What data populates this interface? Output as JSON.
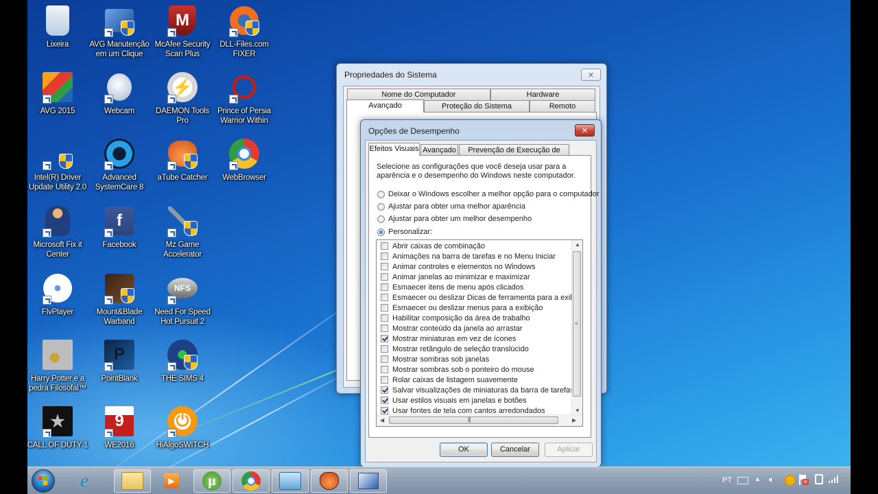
{
  "desktop": {
    "icons": [
      {
        "label": "Lixeira",
        "icon": "recycle-bin-icon"
      },
      {
        "label": "AVG Manutenção em um Clique",
        "icon": "avg-pc-tuneup-icon"
      },
      {
        "label": "McAfee Security Scan Plus",
        "icon": "mcafee-shield-icon"
      },
      {
        "label": "DLL-Files.com FIXER",
        "icon": "dll-fixer-gear-icon"
      },
      {
        "label": "AVG 2015",
        "icon": "avg-antivirus-icon"
      },
      {
        "label": "Webcam",
        "icon": "webcam-icon"
      },
      {
        "label": "DAEMON Tools Pro",
        "icon": "daemon-tools-icon"
      },
      {
        "label": "Prince of Persia Warrior Within",
        "icon": "prince-of-persia-icon"
      },
      {
        "label": "Intel(R) Driver Update Utility 2.0",
        "icon": "intel-driver-icon"
      },
      {
        "label": "Advanced SystemCare 8",
        "icon": "advanced-systemcare-icon"
      },
      {
        "label": "aTube Catcher",
        "icon": "atube-catcher-glove-icon"
      },
      {
        "label": "WebBrowser",
        "icon": "web-browser-icon"
      },
      {
        "label": "Microsoft Fix it Center",
        "icon": "fix-it-mechanic-icon"
      },
      {
        "label": "Facebook",
        "icon": "facebook-icon"
      },
      {
        "label": "Mz Game Accelerator",
        "icon": "wrench-icon"
      },
      {
        "label": "FlvPlayer",
        "icon": "film-reel-icon"
      },
      {
        "label": "Mount&Blade Warband",
        "icon": "horse-icon"
      },
      {
        "label": "Need For Speed Hot Pursuit 2",
        "icon": "nfs-logo-icon"
      },
      {
        "label": "Harry Potter e a pedra Filosofal™",
        "icon": "snitch-icon"
      },
      {
        "label": "PointBlank",
        "icon": "pointblank-icon"
      },
      {
        "label": "THE SIMS 4",
        "icon": "sims-plumbob-icon"
      },
      {
        "label": "CALL OF DUTY 1",
        "icon": "star-icon"
      },
      {
        "label": "WE2016",
        "icon": "we9-icon"
      },
      {
        "label": "HiAlgoSWITCH",
        "icon": "power-icon"
      }
    ]
  },
  "system_properties": {
    "title": "Propriedades do Sistema",
    "tabs_row1": [
      "Nome do Computador",
      "Hardware"
    ],
    "tabs_row2": [
      "Avançado",
      "Proteção do Sistema",
      "Remoto"
    ],
    "selected_tab": "Avançado"
  },
  "performance_options": {
    "title": "Opções de Desempenho",
    "tabs": [
      "Efeitos Visuais",
      "Avançado",
      "Prevenção de Execução de Dados"
    ],
    "selected_tab": "Efeitos Visuais",
    "description": "Selecione as configurações que você deseja usar para a aparência e o desempenho do Windows neste computador.",
    "description_lines": [
      "Selecione as configurações que você deseja usar para a",
      "aparência e o desempenho do Windows neste computador."
    ],
    "radio_options": [
      {
        "label": "Deixar o Windows escolher a melhor opção para o computador",
        "selected": false
      },
      {
        "label": "Ajustar para obter uma melhor aparência",
        "selected": false
      },
      {
        "label": "Ajustar para obter um melhor desempenho",
        "selected": false
      },
      {
        "label": "Personalizar:",
        "selected": true
      }
    ],
    "effects": [
      {
        "label": "Abrir caixas de combinação",
        "checked": false
      },
      {
        "label": "Animações na barra de tarefas e no Menu Iniciar",
        "checked": false
      },
      {
        "label": "Animar controles e elementos no Windows",
        "checked": false
      },
      {
        "label": "Animar janelas ao minimizar e maximizar",
        "checked": false
      },
      {
        "label": "Esmaecer itens de menu após clicados",
        "checked": false
      },
      {
        "label": "Esmaecer ou deslizar Dicas de ferramenta para a exibição",
        "checked": false
      },
      {
        "label": "Esmaecer ou deslizar menus para a exibição",
        "checked": false
      },
      {
        "label": "Habilitar composição da área de trabalho",
        "checked": false
      },
      {
        "label": "Mostrar conteúdo da janela ao arrastar",
        "checked": false
      },
      {
        "label": "Mostrar miniaturas em vez de ícones",
        "checked": true
      },
      {
        "label": "Mostrar retângulo de seleção translúcido",
        "checked": false
      },
      {
        "label": "Mostrar sombras sob janelas",
        "checked": false
      },
      {
        "label": "Mostrar sombras sob o ponteiro do mouse",
        "checked": false
      },
      {
        "label": "Rolar caixas de listagem suavemente",
        "checked": false
      },
      {
        "label": "Salvar visualizações de miniaturas da barra de tarefas",
        "checked": true
      },
      {
        "label": "Usar estilos visuais em janelas e botões",
        "checked": true
      },
      {
        "label": "Usar fontes de tela com cantos arredondados",
        "checked": true
      }
    ],
    "buttons": {
      "ok": "OK",
      "cancel": "Cancelar",
      "apply": "Aplicar"
    },
    "apply_enabled": false
  },
  "taskbar": {
    "start": "start-orb-icon",
    "items": [
      {
        "name": "Internet Explorer",
        "icon": "internet-explorer-icon",
        "pinned_frame": false
      },
      {
        "name": "Windows Explorer",
        "icon": "folder-icon",
        "pinned_frame": true
      },
      {
        "name": "Windows Media Player",
        "icon": "media-player-icon",
        "pinned_frame": false
      },
      {
        "name": "uTorrent",
        "icon": "utorrent-icon",
        "pinned_frame": true
      },
      {
        "name": "WebBrowser",
        "icon": "web-browser-icon",
        "pinned_frame": true
      },
      {
        "name": "Control Panel",
        "icon": "control-panel-icon",
        "pinned_frame": true
      },
      {
        "name": "aTube Catcher",
        "icon": "atube-catcher-glove-icon",
        "pinned_frame": true
      },
      {
        "name": "System Properties",
        "icon": "system-properties-icon",
        "pinned_frame": true
      }
    ],
    "tray": {
      "language": "PT",
      "icons": [
        "keyboard-icon",
        "show-hidden-icons-arrow",
        "volume-icon",
        "power-switch-icon",
        "action-center-flag-icon",
        "power-plug-icon",
        "signal-bars-icon"
      ]
    }
  }
}
